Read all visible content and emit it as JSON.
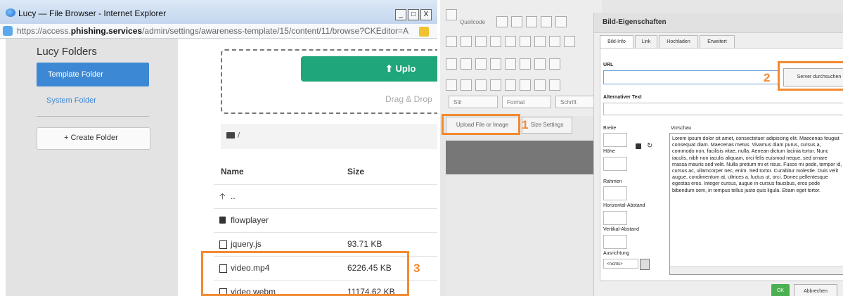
{
  "left_window": {
    "title": "Lucy — File Browser - Internet Explorer",
    "window_controls": {
      "minimize": "_",
      "maximize": "□",
      "close": "X"
    },
    "url": {
      "prefix": "https://access.",
      "domain": "phishing.services",
      "path": "/admin/settings/awareness-template/15/content/11/browse?CKEditor=A"
    },
    "sidebar": {
      "title": "Lucy Folders",
      "items": [
        {
          "label": "Template Folder",
          "active": true
        },
        {
          "label": "System Folder",
          "active": false
        }
      ],
      "create_button": "+ Create Folder"
    },
    "upload": {
      "button_label": "⬆ Uplo",
      "drag_text": "Drag & Drop"
    },
    "path": "/",
    "table": {
      "headers": {
        "name": "Name",
        "size": "Size"
      },
      "rows": [
        {
          "name": "..",
          "size": "",
          "icon": "arrow-up-icon"
        },
        {
          "name": "flowplayer",
          "size": "",
          "icon": "folder-icon"
        },
        {
          "name": "jquery.js",
          "size": "93.71 KB",
          "icon": "file-icon"
        },
        {
          "name": "video.mp4",
          "size": "6226.45 KB",
          "icon": "file-icon"
        },
        {
          "name": "video.webm",
          "size": "11174.62 KB",
          "icon": "file-icon"
        }
      ]
    },
    "annotation_3": "3"
  },
  "right_window": {
    "toolbar": {
      "source_label": "Quellcode",
      "style_combo": "Stil",
      "format_combo": "Format",
      "font_combo": "Schrift"
    },
    "upload_file_button": "Upload File or Image",
    "size_settings_button": "Size Settings",
    "annotation_1": "1",
    "annotation_2": "2",
    "dialog": {
      "title": "Bild-Eigenschaften",
      "tabs": [
        "Bild-Info",
        "Link",
        "Hochladen",
        "Erweitert"
      ],
      "url_label": "URL",
      "server_button": "Server durchsuchen",
      "alt_label": "Alternativer Text",
      "width_label": "Breite",
      "height_label": "Höhe",
      "border_label": "Rahmen",
      "hspace_label": "Horizontal-Abstand",
      "vspace_label": "Vertikal-Abstand",
      "align_label": "Ausrichtung",
      "align_value": "<nichts>",
      "preview_label": "Vorschau",
      "preview_text": "Lorem ipsum dolor sit amet, consectetuer adipiscing elit. Maecenas feugiat consequat diam. Maecenas metus. Vivamus diam purus, cursus a, commodo non, facilisis vitae, nulla. Aenean dictum lacinia tortor. Nunc iaculis, nibh non iaculis aliquam, orci felis euismod neque, sed ornare massa mauris sed velit. Nulla pretium mi et risus. Fusce mi pede, tempor id, cursus ac, ullamcorper nec, enim. Sed tortor. Curabitur molestie. Duis velit augue, condimentum at, ultrices a, luctus ut, orci. Donec pellentesque egestas eros. Integer cursus, augue in cursus faucibus, eros pede bibendum sem, in tempus tellus justo quis ligula. Etiam eget tortor.",
      "ok_button": "OK",
      "cancel_button": "Abbrechen"
    }
  },
  "colors": {
    "highlight": "#f28a30",
    "primary_blue": "#3d88d4",
    "upload_green": "#1fa67a",
    "ok_green": "#4caf50"
  }
}
